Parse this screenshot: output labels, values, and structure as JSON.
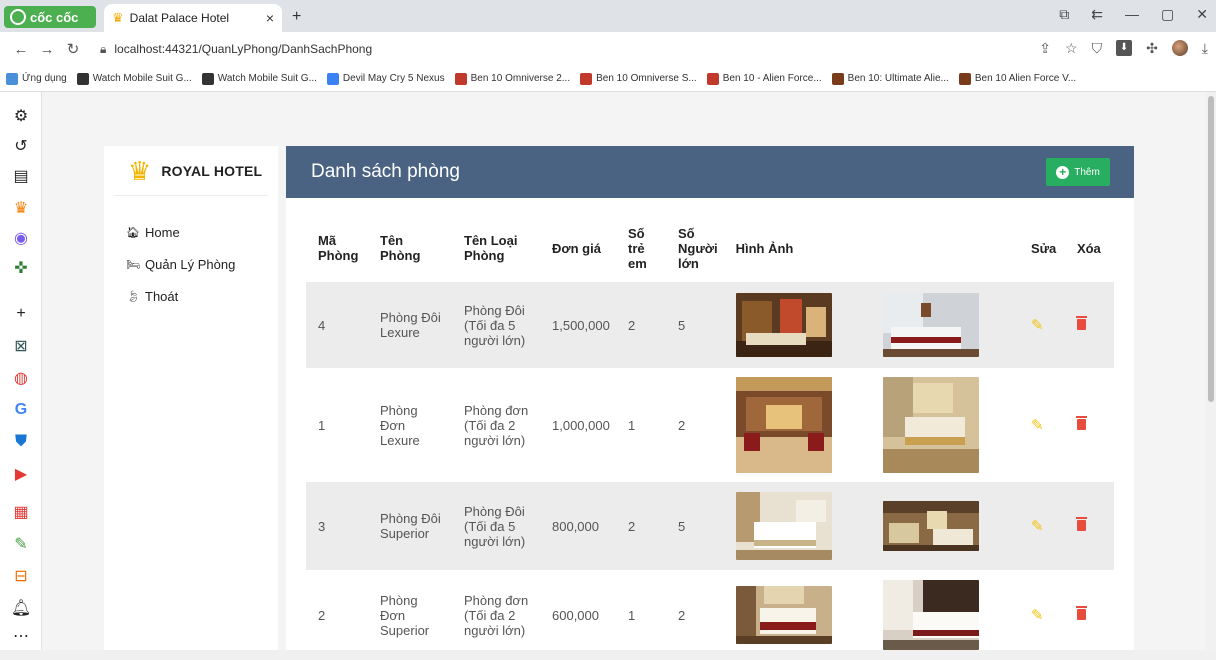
{
  "browser": {
    "brand": "cốc cốc",
    "tab_title": "Dalat Palace Hotel",
    "tab_close": "×",
    "new_tab": "+",
    "url": "localhost:44321/QuanLyPhong/DanhSachPhong",
    "bookmarks": [
      {
        "label": "Ứng dụng",
        "color": "#4a90d9"
      },
      {
        "label": "Watch Mobile Suit G...",
        "color": "#333333"
      },
      {
        "label": "Watch Mobile Suit G...",
        "color": "#333333"
      },
      {
        "label": "Devil May Cry 5 Nexus",
        "color": "#3b82f6"
      },
      {
        "label": "Ben 10 Omniverse 2...",
        "color": "#c0392b"
      },
      {
        "label": "Ben 10 Omniverse S...",
        "color": "#c0392b"
      },
      {
        "label": "Ben 10 - Alien Force...",
        "color": "#c0392b"
      },
      {
        "label": "Ben 10: Ultimate Alie...",
        "color": "#7a3b1b"
      },
      {
        "label": "Ben 10 Alien Force V...",
        "color": "#7a3b1b"
      }
    ]
  },
  "sidebar": {
    "brand": "ROYAL HOTEL",
    "items": [
      {
        "label": "Home",
        "icon": "home-icon"
      },
      {
        "label": "Quản Lý Phòng",
        "icon": "bed-icon"
      },
      {
        "label": "Thoát",
        "icon": "leaf-icon"
      }
    ]
  },
  "main": {
    "title": "Danh sách phòng",
    "add_label": "Thêm",
    "columns": [
      "Mã Phòng",
      "Tên Phòng",
      "Tên Loại Phòng",
      "Đơn giá",
      "Số trẻ em",
      "Số Người lớn",
      "Hình Ảnh",
      "Sửa",
      "Xóa"
    ],
    "rows": [
      {
        "id": "4",
        "name": "Phòng Đôi Lexure",
        "type": "Phòng Đôi (Tối đa 5 người lớn)",
        "price": "1,500,000",
        "children": "2",
        "adults": "5"
      },
      {
        "id": "1",
        "name": "Phòng Đơn Lexure",
        "type": "Phòng đơn (Tối đa 2 người lớn)",
        "price": "1,000,000",
        "children": "1",
        "adults": "2"
      },
      {
        "id": "3",
        "name": "Phòng Đôi Superior",
        "type": "Phòng Đôi (Tối đa 5 người lớn)",
        "price": "800,000",
        "children": "2",
        "adults": "5"
      },
      {
        "id": "2",
        "name": "Phòng Đơn Superior",
        "type": "Phòng đơn (Tối đa 2 người lớn)",
        "price": "600,000",
        "children": "1",
        "adults": "2"
      }
    ]
  },
  "colors": {
    "header_bg": "#4a6383",
    "add_button": "#27ae60",
    "edit_icon": "#f4c20d",
    "delete_icon": "#e74c3c",
    "brand_green": "#4caf50"
  }
}
